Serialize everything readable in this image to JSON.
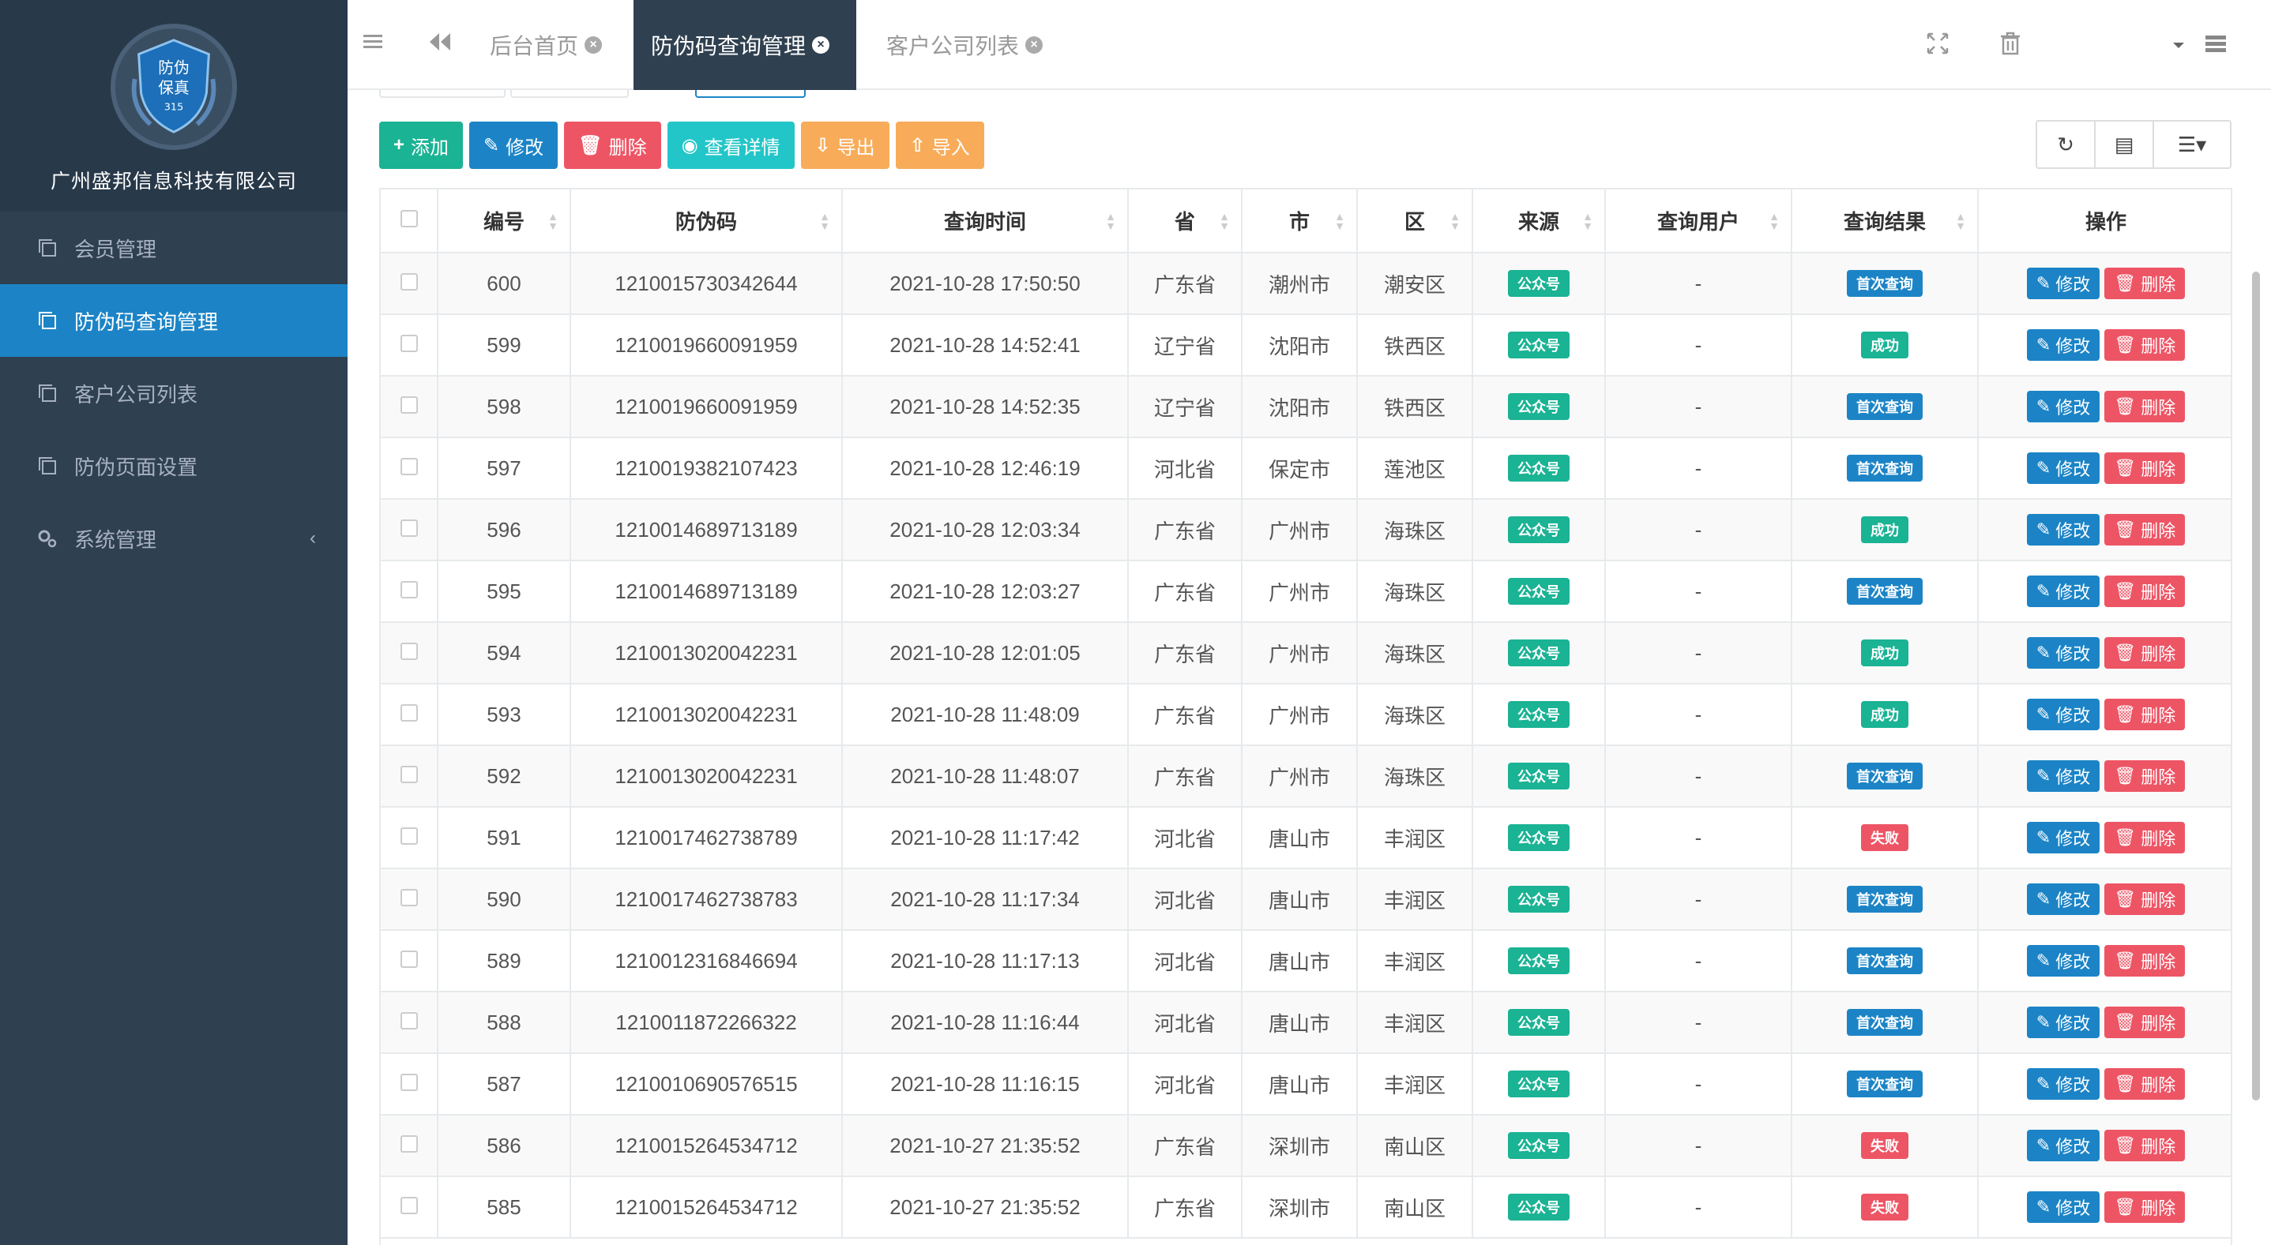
{
  "brand": {
    "logo_text_1": "防伪",
    "logo_text_2": "保真",
    "logo_text_3": "315",
    "company": "广州盛邦信息科技有限公司"
  },
  "sidebar": {
    "items": [
      {
        "label": "会员管理",
        "icon": "copy-icon"
      },
      {
        "label": "防伪码查询管理",
        "icon": "copy-icon",
        "active": true
      },
      {
        "label": "客户公司列表",
        "icon": "copy-icon"
      },
      {
        "label": "防伪页面设置",
        "icon": "copy-icon"
      },
      {
        "label": "系统管理",
        "icon": "gears-icon",
        "caret": "‹"
      }
    ]
  },
  "tabs": [
    {
      "label": "后台首页"
    },
    {
      "label": "防伪码查询管理",
      "active": true
    },
    {
      "label": "客户公司列表"
    }
  ],
  "toolbar": {
    "add": "添加",
    "edit": "修改",
    "delete": "删除",
    "detail": "查看详情",
    "export": "导出",
    "import": "导入"
  },
  "table": {
    "headers": [
      "编号",
      "防伪码",
      "查询时间",
      "省",
      "市",
      "区",
      "来源",
      "查询用户",
      "查询结果",
      "操作"
    ],
    "row_edit": "修改",
    "row_delete": "删除",
    "rows": [
      [
        "600",
        "1210015730342644",
        "2021-10-28 17:50:50",
        "广东省",
        "潮州市",
        "潮安区",
        "公众号",
        "-",
        "首次查询"
      ],
      [
        "599",
        "1210019660091959",
        "2021-10-28 14:52:41",
        "辽宁省",
        "沈阳市",
        "铁西区",
        "公众号",
        "-",
        "成功"
      ],
      [
        "598",
        "1210019660091959",
        "2021-10-28 14:52:35",
        "辽宁省",
        "沈阳市",
        "铁西区",
        "公众号",
        "-",
        "首次查询"
      ],
      [
        "597",
        "1210019382107423",
        "2021-10-28 12:46:19",
        "河北省",
        "保定市",
        "莲池区",
        "公众号",
        "-",
        "首次查询"
      ],
      [
        "596",
        "1210014689713189",
        "2021-10-28 12:03:34",
        "广东省",
        "广州市",
        "海珠区",
        "公众号",
        "-",
        "成功"
      ],
      [
        "595",
        "1210014689713189",
        "2021-10-28 12:03:27",
        "广东省",
        "广州市",
        "海珠区",
        "公众号",
        "-",
        "首次查询"
      ],
      [
        "594",
        "1210013020042231",
        "2021-10-28 12:01:05",
        "广东省",
        "广州市",
        "海珠区",
        "公众号",
        "-",
        "成功"
      ],
      [
        "593",
        "1210013020042231",
        "2021-10-28 11:48:09",
        "广东省",
        "广州市",
        "海珠区",
        "公众号",
        "-",
        "成功"
      ],
      [
        "592",
        "1210013020042231",
        "2021-10-28 11:48:07",
        "广东省",
        "广州市",
        "海珠区",
        "公众号",
        "-",
        "首次查询"
      ],
      [
        "591",
        "1210017462738789",
        "2021-10-28 11:17:42",
        "河北省",
        "唐山市",
        "丰润区",
        "公众号",
        "-",
        "失败"
      ],
      [
        "590",
        "1210017462738783",
        "2021-10-28 11:17:34",
        "河北省",
        "唐山市",
        "丰润区",
        "公众号",
        "-",
        "首次查询"
      ],
      [
        "589",
        "1210012316846694",
        "2021-10-28 11:17:13",
        "河北省",
        "唐山市",
        "丰润区",
        "公众号",
        "-",
        "首次查询"
      ],
      [
        "588",
        "1210011872266322",
        "2021-10-28 11:16:44",
        "河北省",
        "唐山市",
        "丰润区",
        "公众号",
        "-",
        "首次查询"
      ],
      [
        "587",
        "1210010690576515",
        "2021-10-28 11:16:15",
        "河北省",
        "唐山市",
        "丰润区",
        "公众号",
        "-",
        "首次查询"
      ],
      [
        "586",
        "1210015264534712",
        "2021-10-27 21:35:52",
        "广东省",
        "深圳市",
        "南山区",
        "公众号",
        "-",
        "失败"
      ],
      [
        "585",
        "1210015264534712",
        "2021-10-27 21:35:52",
        "广东省",
        "深圳市",
        "南山区",
        "公众号",
        "-",
        "失败"
      ]
    ]
  },
  "colors": {
    "sidebar": "#2f4050",
    "active": "#1c84c6",
    "green": "#1ab394",
    "red": "#ed5565",
    "cyan": "#23c6c8",
    "orange": "#f8ac59"
  }
}
